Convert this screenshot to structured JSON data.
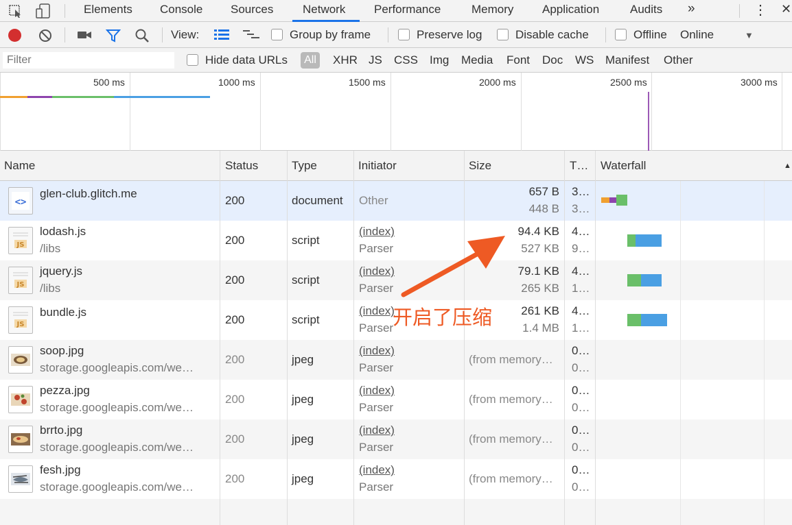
{
  "tabs": {
    "items": [
      "Elements",
      "Console",
      "Sources",
      "Network",
      "Performance",
      "Memory",
      "Application",
      "Audits"
    ],
    "more": "»",
    "menu": "⋮",
    "close": "✕"
  },
  "toolbar": {
    "view_label": "View:",
    "group_by_frame": "Group by frame",
    "preserve_log": "Preserve log",
    "disable_cache": "Disable cache",
    "offline": "Offline",
    "throttle_value": "Online",
    "dropdown_arrow": "▼"
  },
  "filter": {
    "placeholder": "Filter",
    "hide_data_urls": "Hide data URLs",
    "all": "All",
    "types": [
      "XHR",
      "JS",
      "CSS",
      "Img",
      "Media",
      "Font",
      "Doc",
      "WS",
      "Manifest",
      "Other"
    ]
  },
  "overview": {
    "ticks": [
      "500 ms",
      "1000 ms",
      "1500 ms",
      "2000 ms",
      "2500 ms",
      "3000 ms"
    ]
  },
  "table": {
    "headers": [
      "Name",
      "Status",
      "Type",
      "Initiator",
      "Size",
      "T…",
      "Waterfall"
    ],
    "sort_arrow": "▲",
    "rows": [
      {
        "name": "glen-club.glitch.me",
        "path": "",
        "status": "200",
        "type": "document",
        "initiator": "Other",
        "initiator2": "",
        "size": "657 B",
        "size2": "448 B",
        "time": "3…",
        "time2": "3…",
        "icon": "html-file-icon"
      },
      {
        "name": "lodash.js",
        "path": "/libs",
        "status": "200",
        "type": "script",
        "initiator": "(index)",
        "initiator2": "Parser",
        "size": "94.4 KB",
        "size2": "527 KB",
        "time": "4…",
        "time2": "9…",
        "icon": "js-file-icon"
      },
      {
        "name": "jquery.js",
        "path": "/libs",
        "status": "200",
        "type": "script",
        "initiator": "(index)",
        "initiator2": "Parser",
        "size": "79.1 KB",
        "size2": "265 KB",
        "time": "4…",
        "time2": "1…",
        "icon": "js-file-icon"
      },
      {
        "name": "bundle.js",
        "path": "",
        "status": "200",
        "type": "script",
        "initiator": "(index)",
        "initiator2": "Parser",
        "size": "261 KB",
        "size2": "1.4 MB",
        "time": "4…",
        "time2": "1…",
        "icon": "js-file-icon"
      },
      {
        "name": "soop.jpg",
        "path": "storage.googleapis.com/we…",
        "status": "200",
        "type": "jpeg",
        "initiator": "(index)",
        "initiator2": "Parser",
        "size": "(from memory…",
        "size2": "",
        "time": "0…",
        "time2": "0…",
        "icon": "image-thumb-icon"
      },
      {
        "name": "pezza.jpg",
        "path": "storage.googleapis.com/we…",
        "status": "200",
        "type": "jpeg",
        "initiator": "(index)",
        "initiator2": "Parser",
        "size": "(from memory…",
        "size2": "",
        "time": "0…",
        "time2": "0…",
        "icon": "image-thumb-icon"
      },
      {
        "name": "brrto.jpg",
        "path": "storage.googleapis.com/we…",
        "status": "200",
        "type": "jpeg",
        "initiator": "(index)",
        "initiator2": "Parser",
        "size": "(from memory…",
        "size2": "",
        "time": "0…",
        "time2": "0…",
        "icon": "image-thumb-icon"
      },
      {
        "name": "fesh.jpg",
        "path": "storage.googleapis.com/we…",
        "status": "200",
        "type": "jpeg",
        "initiator": "(index)",
        "initiator2": "Parser",
        "size": "(from memory…",
        "size2": "",
        "time": "0…",
        "time2": "0…",
        "icon": "image-thumb-icon"
      }
    ]
  },
  "annotation": {
    "text": "开启了压缩",
    "color": "#ee5a24"
  },
  "colors": {
    "record": "#d32f2f",
    "accent": "#1a73e8",
    "waterfall_wait": "#6abf69",
    "waterfall_download": "#4a9fe3"
  }
}
